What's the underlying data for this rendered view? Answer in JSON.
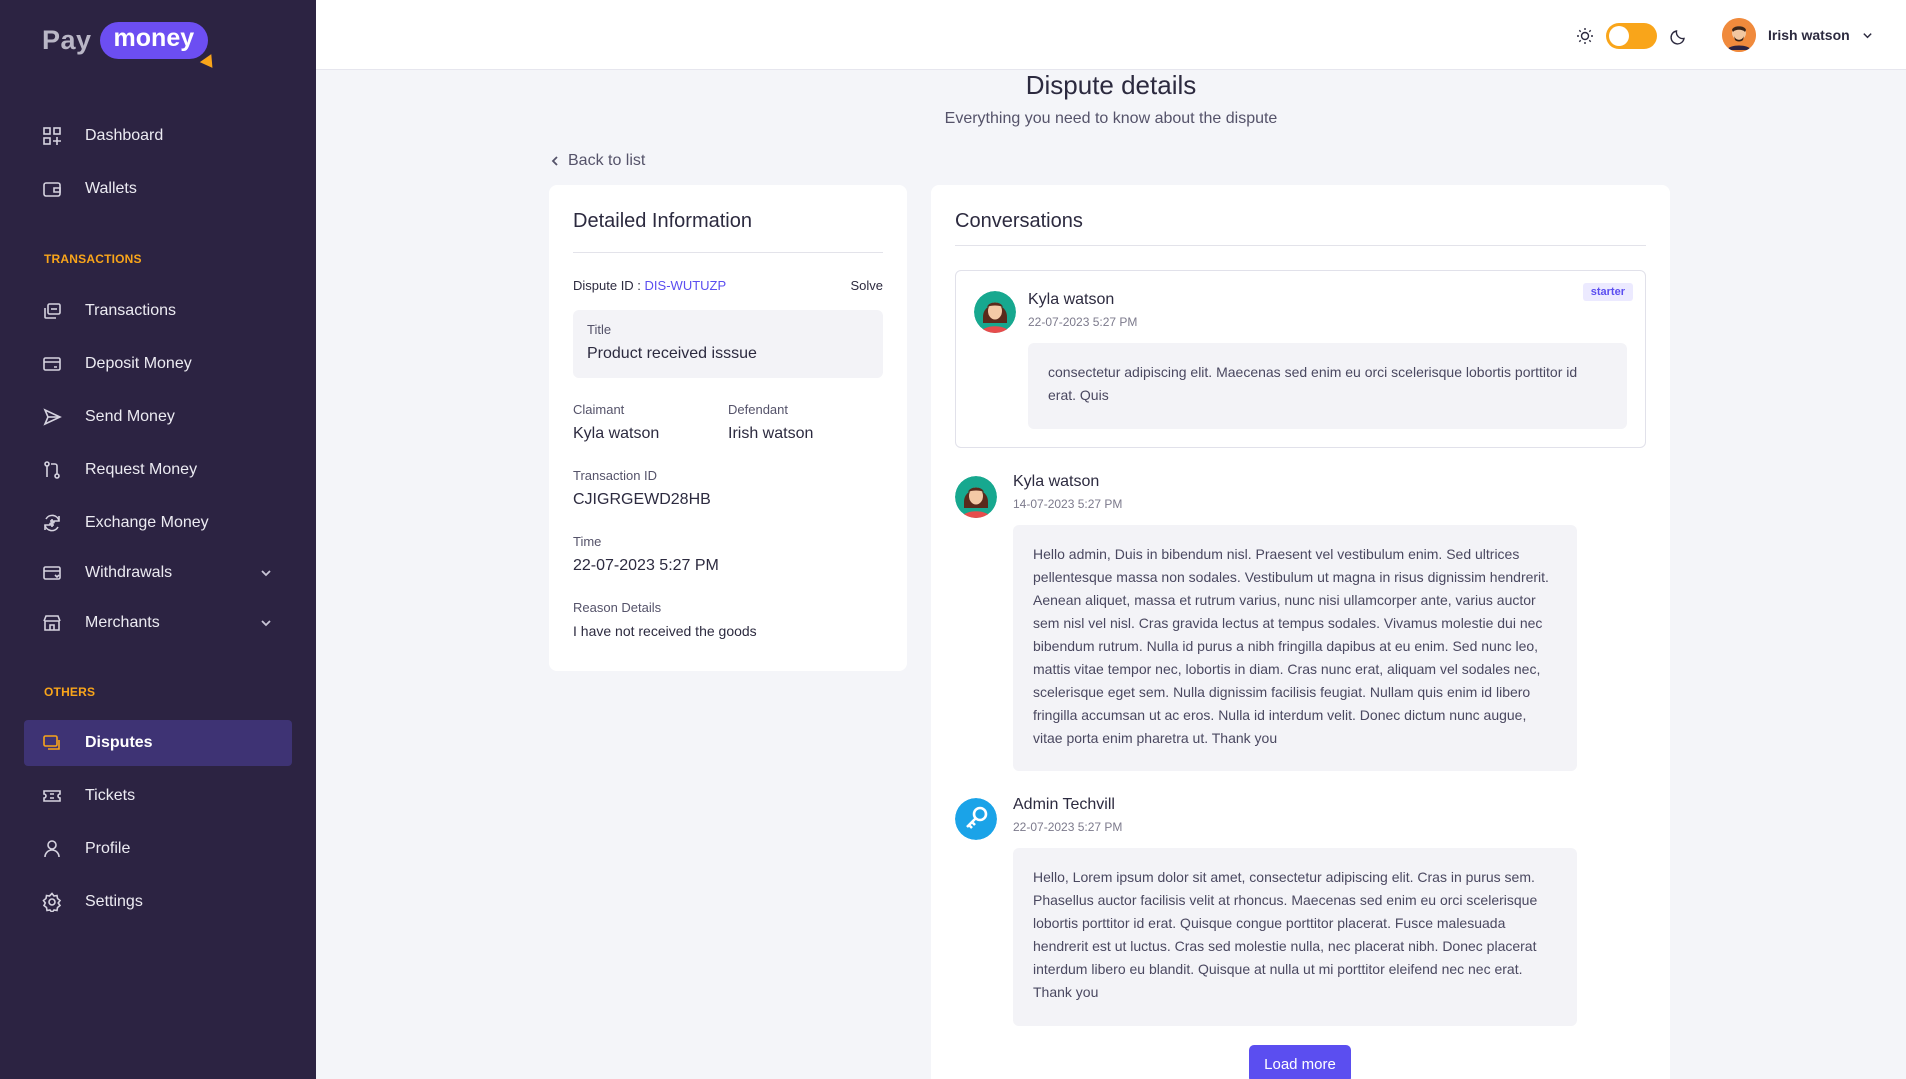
{
  "brand": {
    "pay": "Pay",
    "money": "money"
  },
  "sidebar": {
    "items": [
      {
        "label": "Dashboard",
        "icon": "dashboard-icon"
      },
      {
        "label": "Wallets",
        "icon": "wallet-icon"
      }
    ],
    "transactions_label": "TRANSACTIONS",
    "transaction_items": [
      {
        "label": "Transactions",
        "icon": "transactions-icon"
      },
      {
        "label": "Deposit Money",
        "icon": "deposit-icon"
      },
      {
        "label": "Send Money",
        "icon": "send-icon"
      },
      {
        "label": "Request Money",
        "icon": "request-icon"
      },
      {
        "label": "Exchange Money",
        "icon": "exchange-icon"
      },
      {
        "label": "Withdrawals",
        "icon": "withdraw-icon"
      },
      {
        "label": "Merchants",
        "icon": "merchant-icon"
      }
    ],
    "others_label": "OTHERS",
    "other_items": [
      {
        "label": "Disputes",
        "icon": "dispute-icon",
        "active": true
      },
      {
        "label": "Tickets",
        "icon": "ticket-icon"
      },
      {
        "label": "Profile",
        "icon": "profile-icon"
      },
      {
        "label": "Settings",
        "icon": "settings-icon"
      }
    ]
  },
  "topbar": {
    "user_name": "Irish watson",
    "theme": "light"
  },
  "page": {
    "title": "Dispute details",
    "subtitle": "Everything you need to know about the dispute",
    "back_label": "Back to list"
  },
  "detail": {
    "heading": "Detailed Information",
    "dispute_id_label": "Dispute ID :",
    "dispute_id": "DIS-WUTUZP",
    "status": "Solve",
    "title_label": "Title",
    "title_value": "Product received isssue",
    "claimant_label": "Claimant",
    "claimant": "Kyla watson",
    "defendant_label": "Defendant",
    "defendant": "Irish watson",
    "transaction_label": "Transaction ID",
    "transaction_id": "CJIGRGEWD28HB",
    "time_label": "Time",
    "time": "22-07-2023 5:27 PM",
    "reason_label": "Reason Details",
    "reason": "I have not received the goods"
  },
  "conversations": {
    "heading": "Conversations",
    "starter": {
      "name": "Kyla watson",
      "time": "22-07-2023 5:27 PM",
      "badge": "starter",
      "text": "consectetur adipiscing elit. Maecenas sed enim eu orci scelerisque lobortis porttitor id erat. Quis"
    },
    "messages": [
      {
        "name": "Kyla watson",
        "time": "14-07-2023 5:27 PM",
        "text": "Hello admin, Duis in bibendum nisl. Praesent vel vestibulum enim. Sed ultrices pellentesque massa non sodales. Vestibulum ut magna in risus dignissim hendrerit. Aenean aliquet, massa et rutrum varius, nunc nisi ullamcorper ante, varius auctor sem nisl vel nisl. Cras gravida lectus at tempus sodales. Vivamus molestie dui nec bibendum rutrum. Nulla id purus a nibh fringilla dapibus at eu enim. Sed nunc leo, mattis vitae tempor nec, lobortis in diam. Cras nunc erat, aliquam vel sodales nec, scelerisque eget sem. Nulla dignissim facilisis feugiat. Nullam quis enim id libero fringilla accumsan ut ac eros. Nulla id interdum velit. Donec dictum nunc augue, vitae porta enim pharetra ut. Thank you"
      },
      {
        "name": "Admin Techvill",
        "time": "22-07-2023 5:27 PM",
        "text": "Hello, Lorem ipsum dolor sit amet, consectetur adipiscing elit. Cras in purus sem. Phasellus auctor facilisis velit at rhoncus. Maecenas sed enim eu orci scelerisque lobortis porttitor id erat. Quisque congue porttitor placerat. Fusce malesuada hendrerit est ut luctus. Cras sed molestie nulla, nec placerat nibh. Donec placerat interdum libero eu blandit. Quisque at nulla ut mi porttitor eleifend nec nec erat. Thank you"
      }
    ],
    "load_more_label": "Load more"
  },
  "colors": {
    "sidebar_bg": "#2c2342",
    "accent": "#5b4ef0",
    "highlight": "#f9a51a"
  }
}
